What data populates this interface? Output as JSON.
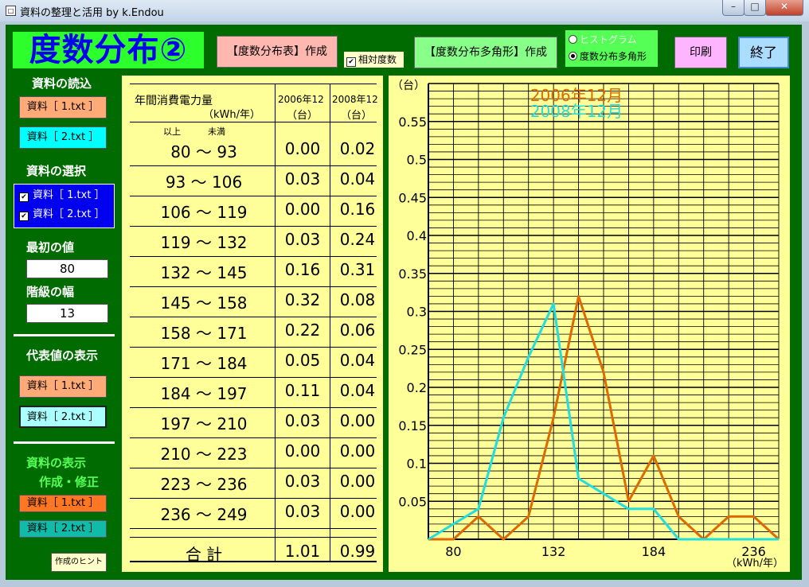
{
  "window": {
    "title": "資料の整理と活用  by k.Endou",
    "app_icon": "□"
  },
  "header": {
    "page_title": "度数分布②",
    "table_button": "【度数分布表】作成",
    "relative_check_label": "相対度数",
    "polygon_button": "【度数分布多角形】作成",
    "radio_histogram": "ヒストグラム",
    "radio_polygon": "度数分布多角形",
    "print_button": "印刷",
    "quit_button": "終了"
  },
  "sidebar": {
    "load_label": "資料の読込",
    "load_btn1": "資料［ 1.txt ］",
    "load_btn2": "資料［ 2.txt ］",
    "select_label": "資料の選択",
    "sel_item1": "資料［ 1.txt ］",
    "sel_item2": "資料［ 2.txt ］",
    "first_value_label": "最初の値",
    "first_value": "80",
    "class_width_label": "階級の幅",
    "class_width": "13",
    "rep_label": "代表値の表示",
    "rep_btn1": "資料［ 1.txt ］",
    "rep_btn2": "資料［ 2.txt ］",
    "display_label": "資料の表示",
    "edit_label": "作成・修正",
    "disp_btn1": "資料［ 1.txt ］",
    "disp_btn2": "資料［ 2.txt ］",
    "hint_button": "作成のヒント"
  },
  "table": {
    "header_title": "年間消費電力量",
    "header_unit": "（kWh/年）",
    "header_ijo": "以上",
    "header_miman": "未満",
    "col1": "2006年12",
    "col2": "2008年12",
    "col_unit": "（台）",
    "rows": [
      {
        "range": "80 〜  93",
        "v1": "0.00",
        "v2": "0.02"
      },
      {
        "range": "93 〜 106",
        "v1": "0.03",
        "v2": "0.04"
      },
      {
        "range": "106 〜 119",
        "v1": "0.00",
        "v2": "0.16"
      },
      {
        "range": "119 〜 132",
        "v1": "0.03",
        "v2": "0.24"
      },
      {
        "range": "132 〜 145",
        "v1": "0.16",
        "v2": "0.31"
      },
      {
        "range": "145 〜 158",
        "v1": "0.32",
        "v2": "0.08"
      },
      {
        "range": "158 〜 171",
        "v1": "0.22",
        "v2": "0.06"
      },
      {
        "range": "171 〜 184",
        "v1": "0.05",
        "v2": "0.04"
      },
      {
        "range": "184 〜 197",
        "v1": "0.11",
        "v2": "0.04"
      },
      {
        "range": "197 〜 210",
        "v1": "0.03",
        "v2": "0.00"
      },
      {
        "range": "210 〜 223",
        "v1": "0.00",
        "v2": "0.00"
      },
      {
        "range": "223 〜 236",
        "v1": "0.03",
        "v2": "0.00"
      },
      {
        "range": "236 〜 249",
        "v1": "0.03",
        "v2": "0.00"
      }
    ],
    "total_label": "合 計",
    "total1": "1.01",
    "total2": "0.99"
  },
  "chart_data": {
    "type": "line",
    "y_unit": "（台）",
    "x_unit": "（kWh/年）",
    "y_ticks": [
      "0.05",
      "0.1",
      "0.15",
      "0.2",
      "0.25",
      "0.3",
      "0.35",
      "0.4",
      "0.45",
      "0.5",
      "0.55"
    ],
    "x_ticks": [
      "80",
      "132",
      "184",
      "236"
    ],
    "ylim": [
      0,
      0.6
    ],
    "xlim": [
      73.5,
      255.5
    ],
    "grid": true,
    "legend_placement": "top",
    "x": [
      73.5,
      86.5,
      99.5,
      112.5,
      125.5,
      138.5,
      151.5,
      164.5,
      177.5,
      190.5,
      203.5,
      216.5,
      229.5,
      242.5,
      255.5
    ],
    "series": [
      {
        "name": "2006年12月",
        "color": "#dd6a00",
        "values": [
          0,
          0,
          0.03,
          0,
          0.03,
          0.16,
          0.32,
          0.22,
          0.05,
          0.11,
          0.03,
          0,
          0.03,
          0.03,
          0
        ]
      },
      {
        "name": "2008年12月",
        "color": "#22dddd",
        "values": [
          0,
          0.02,
          0.04,
          0.16,
          0.24,
          0.31,
          0.08,
          0.06,
          0.04,
          0.04,
          0,
          0,
          0,
          0,
          0
        ]
      }
    ]
  }
}
